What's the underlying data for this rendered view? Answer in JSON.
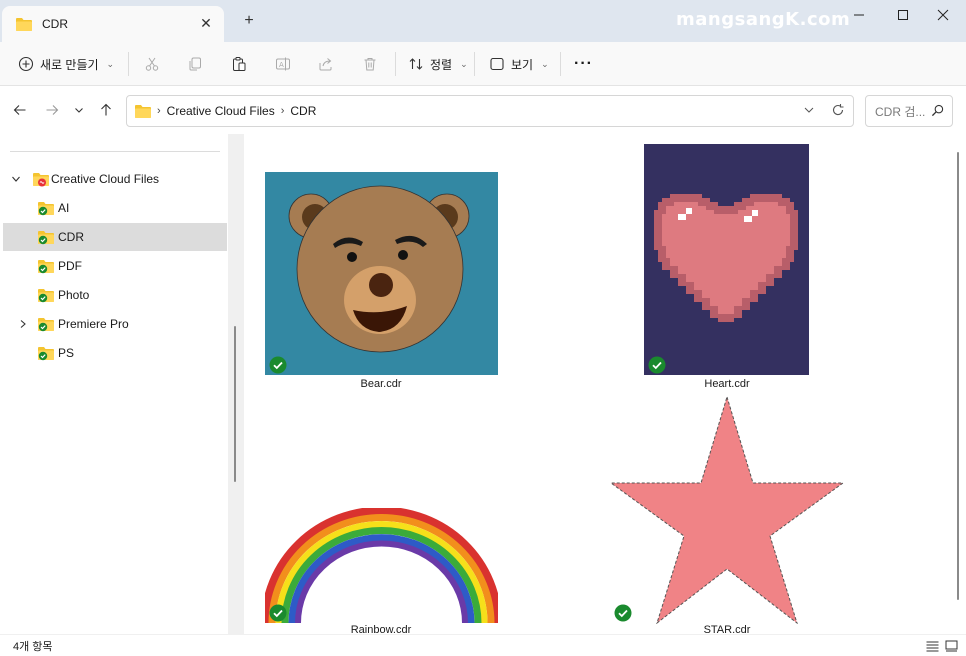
{
  "window": {
    "tab_title": "CDR",
    "watermark": "mangsangK.com"
  },
  "toolbar": {
    "new_label": "새로 만들기",
    "sort_label": "정렬",
    "view_label": "보기",
    "more_label": "···"
  },
  "nav": {
    "breadcrumb": [
      "Creative Cloud Files",
      "CDR"
    ],
    "search_placeholder": "CDR 검..."
  },
  "sidebar": {
    "root": "Creative Cloud Files",
    "items": [
      {
        "label": "AI"
      },
      {
        "label": "CDR",
        "selected": true
      },
      {
        "label": "PDF"
      },
      {
        "label": "Photo"
      },
      {
        "label": "Premiere Pro",
        "expandable": true
      },
      {
        "label": "PS"
      }
    ]
  },
  "files": [
    {
      "name": "Bear.cdr",
      "status": "synced"
    },
    {
      "name": "Heart.cdr",
      "status": "synced"
    },
    {
      "name": "Rainbow.cdr",
      "status": "synced"
    },
    {
      "name": "STAR.cdr",
      "status": "synced"
    }
  ],
  "status": {
    "item_count": "4개 항목"
  },
  "colors": {
    "titlebar": "#dfe6ef",
    "sync_green": "#1a8a2e",
    "folder_yellow": "#f4c430",
    "selected_row": "#dcdcdc",
    "bear_bg": "#3388a3",
    "heart_bg": "#343060",
    "heart_fill": "#de7a80",
    "star_fill": "#f08386"
  }
}
